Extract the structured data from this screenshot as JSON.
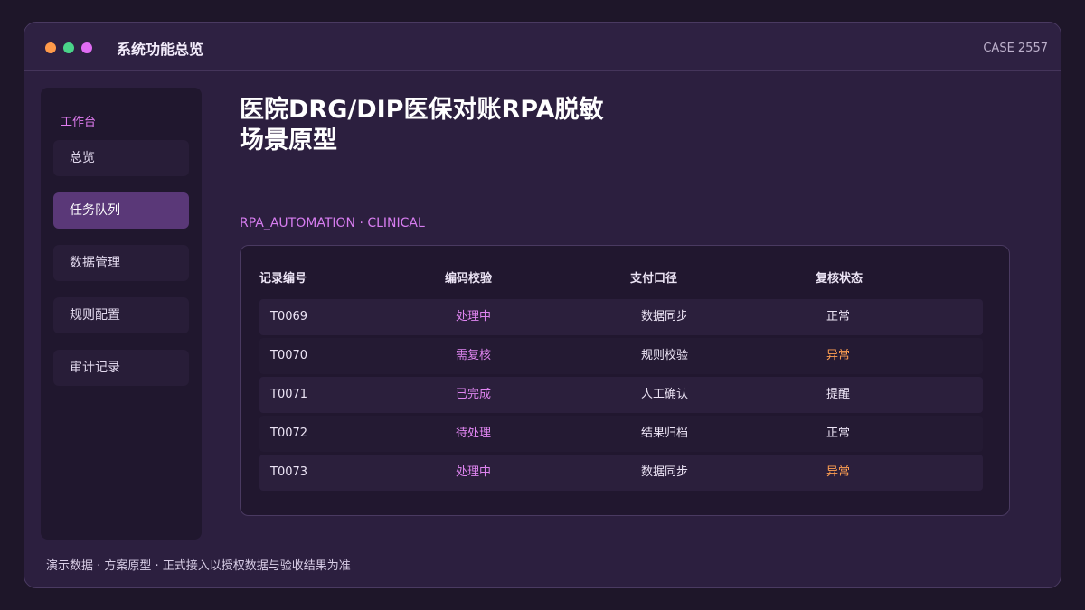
{
  "window": {
    "title": "系统功能总览",
    "case_label": "CASE 2557"
  },
  "sidebar": {
    "heading": "工作台",
    "items": [
      {
        "label": "总览",
        "active": false
      },
      {
        "label": "任务队列",
        "active": true
      },
      {
        "label": "数据管理",
        "active": false
      },
      {
        "label": "规则配置",
        "active": false
      },
      {
        "label": "审计记录",
        "active": false
      }
    ]
  },
  "main": {
    "title": "医院DRG/DIP医保对账RPA脱敏场景原型",
    "subtitle": "RPA_AUTOMATION · CLINICAL"
  },
  "table": {
    "headers": [
      "记录编号",
      "编码校验",
      "支付口径",
      "复核状态"
    ],
    "rows": [
      {
        "id": "T0069",
        "code_check": "处理中",
        "payment": "数据同步",
        "review": "正常",
        "review_status": "normal"
      },
      {
        "id": "T0070",
        "code_check": "需复核",
        "payment": "规则校验",
        "review": "异常",
        "review_status": "warn"
      },
      {
        "id": "T0071",
        "code_check": "已完成",
        "payment": "人工确认",
        "review": "提醒",
        "review_status": "normal"
      },
      {
        "id": "T0072",
        "code_check": "待处理",
        "payment": "结果归档",
        "review": "正常",
        "review_status": "normal"
      },
      {
        "id": "T0073",
        "code_check": "处理中",
        "payment": "数据同步",
        "review": "异常",
        "review_status": "warn"
      }
    ]
  },
  "footer": {
    "text": "演示数据 · 方案原型 · 正式接入以授权数据与验收结果为准"
  },
  "colors": {
    "accent": "#df85f0",
    "warning": "#ff9f52",
    "active_nav": "#5a3878"
  }
}
